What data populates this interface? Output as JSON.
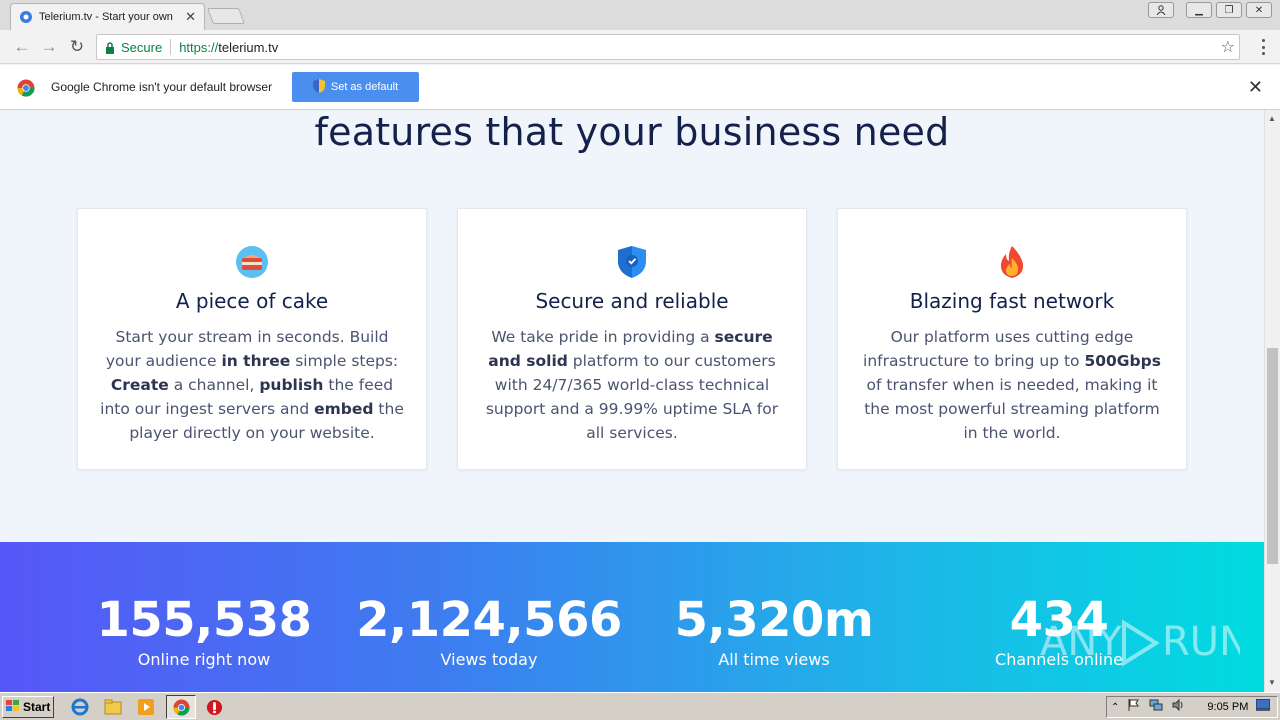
{
  "browser": {
    "tab_title": "Telerium.tv - Start your own",
    "secure_label": "Secure",
    "url_scheme": "https://",
    "url_host": "telerium.tv"
  },
  "infobar": {
    "message": "Google Chrome isn't your default browser",
    "button_label": "Set as default"
  },
  "page": {
    "headline": "features that your business need",
    "cards": [
      {
        "icon": "cake-icon",
        "title": "A piece of cake",
        "body": [
          {
            "t": "Start your stream in seconds. Build your audience "
          },
          {
            "t": "in three",
            "b": true
          },
          {
            "t": " simple steps: "
          },
          {
            "t": "Create",
            "b": true
          },
          {
            "t": " a channel, "
          },
          {
            "t": "publish",
            "b": true
          },
          {
            "t": " the feed into our ingest servers and "
          },
          {
            "t": "embed",
            "b": true
          },
          {
            "t": " the player directly on your website."
          }
        ]
      },
      {
        "icon": "shield-check-icon",
        "title": "Secure and reliable",
        "body": [
          {
            "t": "We take pride in providing a "
          },
          {
            "t": "secure and solid",
            "b": true
          },
          {
            "t": " platform to our customers with 24/7/365 world-class technical support and a 99.99% uptime SLA for all services."
          }
        ]
      },
      {
        "icon": "fire-icon",
        "title": "Blazing fast network",
        "body": [
          {
            "t": "Our platform uses cutting edge infrastructure to bring up to "
          },
          {
            "t": "500Gbps",
            "b": true
          },
          {
            "t": " of transfer when is needed, making it the most powerful streaming platform in the world."
          }
        ]
      }
    ],
    "stats": [
      {
        "value": "155,538",
        "label": "Online right now"
      },
      {
        "value": "2,124,566",
        "label": "Views today"
      },
      {
        "value": "5,320m",
        "label": "All time views"
      },
      {
        "value": "434",
        "label": "Channels online"
      }
    ]
  },
  "watermark": "ANY RUN",
  "taskbar": {
    "start_label": "Start",
    "clock": "9:05 PM"
  }
}
